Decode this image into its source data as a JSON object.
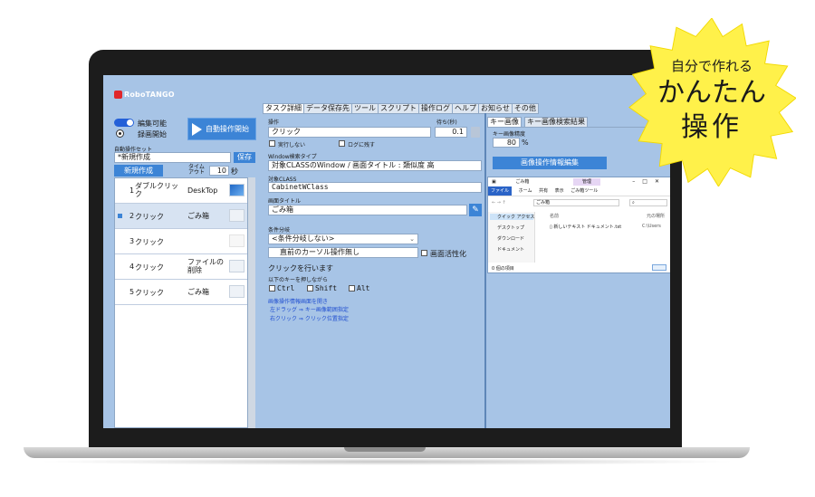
{
  "app": {
    "logo_text": "RoboTANGO"
  },
  "left": {
    "toggle_label": "編集可能",
    "radio_label": "録画開始",
    "auto_run_button": "自動操作開始",
    "set_label": "自動操作セット",
    "set_value": "*新規作成",
    "save_button": "保存",
    "new_button": "新規作成",
    "timeout_label_1": "タイム",
    "timeout_label_2": "アウト",
    "timeout_value": "10",
    "timeout_unit": "秒",
    "steps": [
      {
        "num": "1",
        "action": "ダブルクリック",
        "target": "DeskTop"
      },
      {
        "num": "2",
        "action": "クリック",
        "target": "ごみ箱"
      },
      {
        "num": "3",
        "action": "クリック",
        "target": ""
      },
      {
        "num": "4",
        "action": "クリック",
        "target": "ファイルの削除"
      },
      {
        "num": "5",
        "action": "クリック",
        "target": "ごみ箱"
      }
    ]
  },
  "tabs": [
    "タスク詳細",
    "データ保存先",
    "ツール",
    "スクリプト",
    "操作ログ",
    "ヘルプ",
    "お知らせ",
    "その他"
  ],
  "center": {
    "op_label": "操作",
    "wait_label": "待ち(秒)",
    "op_value": "クリック",
    "wait_value": "0.1",
    "no_exec_label": "実行しない",
    "log_label": "ログに残す",
    "window_search_label": "Window検索タイプ",
    "window_search_value": "対象CLASSのWindow / 画面タイトル : 類似度 高",
    "target_class_label": "対象CLASS",
    "target_class_value": "CabinetWClass",
    "screen_title_label": "画面タイトル",
    "screen_title_value": "ごみ箱",
    "branch_label": "条件分岐",
    "branch_value": "<条件分岐しない>",
    "prev_cursor_value": "直前のカーソル操作無し",
    "screen_active_label": "画面活性化",
    "click_label": "クリックを行います",
    "keys_label": "以下のキーを押しながら",
    "key_ctrl": "Ctrl",
    "key_shift": "Shift",
    "key_alt": "Alt",
    "hint_1": "画像操作情報画面を開き",
    "hint_2": "左ドラッグ ⇒ キー画像範囲指定",
    "hint_3": "右クリック ⇒ クリック位置指定"
  },
  "right": {
    "tab_key_image": "キー画像",
    "tab_key_search": "キー画像検索結果",
    "accuracy_label": "キー画像精度",
    "accuracy_value": "80",
    "accuracy_unit": "%",
    "edit_button": "画像操作情報編集",
    "explorer": {
      "title": "ごみ箱",
      "manage_tab": "管理",
      "ribbon_file": "ファイル",
      "ribbon_home": "ホーム",
      "ribbon_share": "共有",
      "ribbon_view": "表示",
      "ribbon_tools": "ごみ箱ツール",
      "address": "ごみ箱",
      "nav_quick": "クイック アクセス",
      "nav_desktop": "デスクトップ",
      "nav_download": "ダウンロード",
      "nav_documents": "ドキュメント",
      "col_name": "名前",
      "col_location": "元の場所",
      "file_name": "新しいテキスト ドキュメント.txt",
      "file_location": "C:\\Users",
      "status": "0 個の項目"
    }
  },
  "badge": {
    "line1": "自分で作れる",
    "line2": "かんたん",
    "line3": "操作",
    "color": "#fff14a"
  }
}
